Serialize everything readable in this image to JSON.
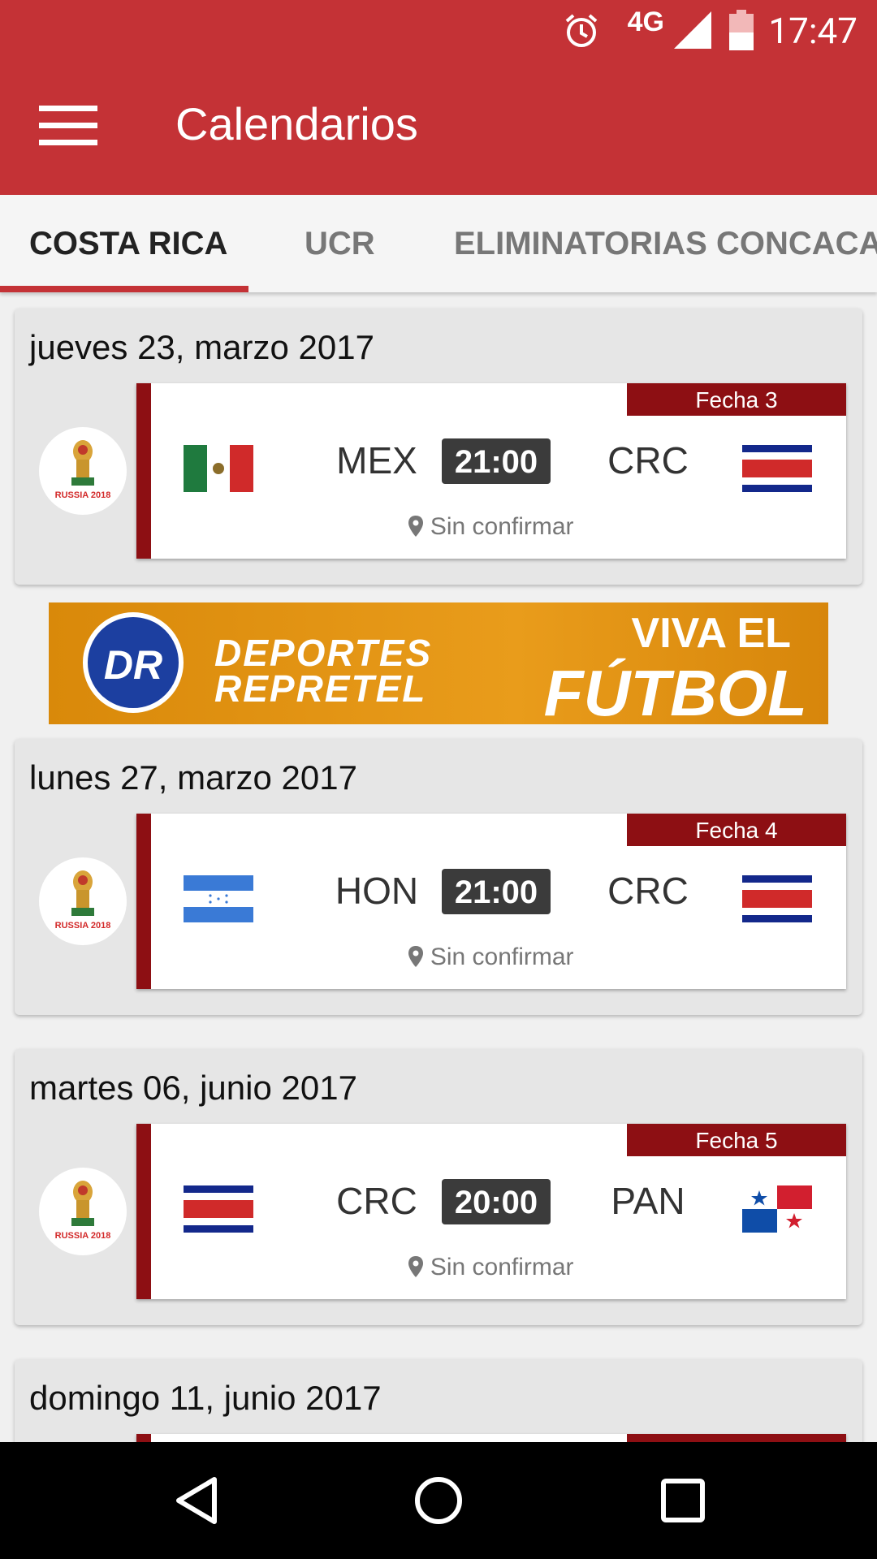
{
  "status_bar": {
    "network": "4G",
    "time": "17:47"
  },
  "app_bar": {
    "title": "Calendarios"
  },
  "tabs": [
    {
      "label": "COSTA RICA"
    },
    {
      "label": "UCR"
    },
    {
      "label": "ELIMINATORIAS CONCACAF"
    }
  ],
  "banner": {
    "logo": "DR",
    "line1": "DEPORTES",
    "line2": "REPRETEL",
    "tagline1": "VIVA EL",
    "tagline2": "FÚTBOL"
  },
  "matches": [
    {
      "date": "jueves 23, marzo 2017",
      "fecha": "Fecha 3",
      "home": "MEX",
      "away": "CRC",
      "time": "21:00",
      "venue": "Sin confirmar",
      "home_flag": "mexico",
      "away_flag": "costa-rica"
    },
    {
      "date": "lunes 27, marzo 2017",
      "fecha": "Fecha 4",
      "home": "HON",
      "away": "CRC",
      "time": "21:00",
      "venue": "Sin confirmar",
      "home_flag": "honduras",
      "away_flag": "costa-rica"
    },
    {
      "date": "martes 06, junio 2017",
      "fecha": "Fecha 5",
      "home": "CRC",
      "away": "PAN",
      "time": "20:00",
      "venue": "Sin confirmar",
      "home_flag": "costa-rica",
      "away_flag": "panama"
    },
    {
      "date": "domingo 11, junio 2017"
    }
  ],
  "competition_badge": {
    "text": "RUSSIA 2018"
  }
}
